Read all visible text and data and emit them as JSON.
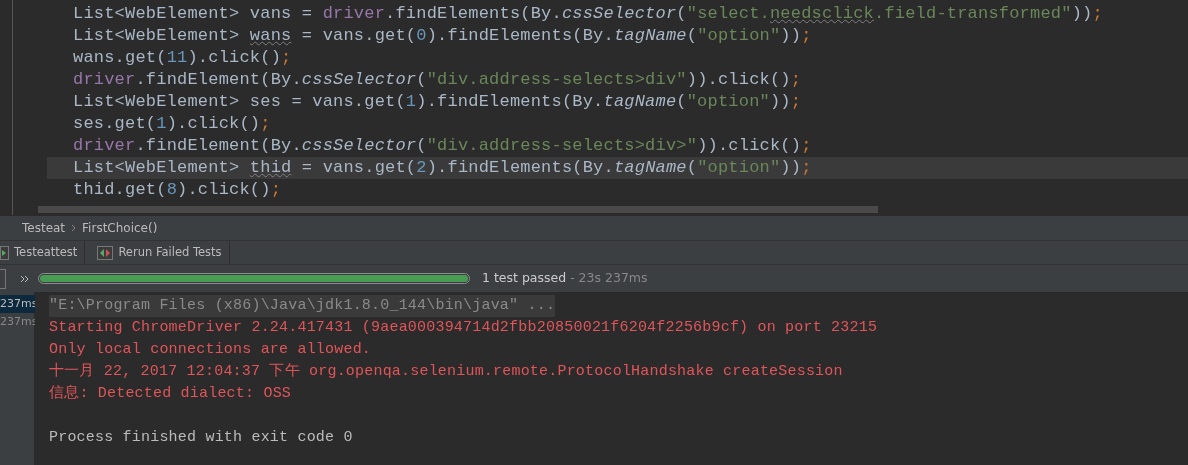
{
  "editor": {
    "lines": [
      {
        "current": false,
        "tokens": [
          {
            "kind": "plain",
            "text": "List<WebElement> vans = "
          },
          {
            "kind": "field",
            "text": "driver"
          },
          {
            "kind": "plain",
            "text": ".findElements(By."
          },
          {
            "kind": "static",
            "text": "cssSelector"
          },
          {
            "kind": "plain",
            "text": "("
          },
          {
            "kind": "string",
            "text": "\"select."
          },
          {
            "kind": "typo-string",
            "text": "needsclick"
          },
          {
            "kind": "string",
            "text": ".field-transformed\""
          },
          {
            "kind": "plain",
            "text": "))"
          },
          {
            "kind": "punct",
            "text": ";"
          }
        ]
      },
      {
        "current": false,
        "tokens": [
          {
            "kind": "plain",
            "text": "List<WebElement> "
          },
          {
            "kind": "typo",
            "text": "wans"
          },
          {
            "kind": "plain",
            "text": " = vans.get("
          },
          {
            "kind": "number",
            "text": "0"
          },
          {
            "kind": "plain",
            "text": ").findElements(By."
          },
          {
            "kind": "static",
            "text": "tagName"
          },
          {
            "kind": "plain",
            "text": "("
          },
          {
            "kind": "string",
            "text": "\"option\""
          },
          {
            "kind": "plain",
            "text": "))"
          },
          {
            "kind": "punct",
            "text": ";"
          }
        ]
      },
      {
        "current": false,
        "tokens": [
          {
            "kind": "plain",
            "text": "wans.get("
          },
          {
            "kind": "number",
            "text": "11"
          },
          {
            "kind": "plain",
            "text": ").click()"
          },
          {
            "kind": "punct",
            "text": ";"
          }
        ]
      },
      {
        "current": false,
        "tokens": [
          {
            "kind": "field",
            "text": "driver"
          },
          {
            "kind": "plain",
            "text": ".findElement(By."
          },
          {
            "kind": "static",
            "text": "cssSelector"
          },
          {
            "kind": "plain",
            "text": "("
          },
          {
            "kind": "string",
            "text": "\"div.address-selects>div\""
          },
          {
            "kind": "plain",
            "text": ")).click()"
          },
          {
            "kind": "punct",
            "text": ";"
          }
        ]
      },
      {
        "current": false,
        "tokens": [
          {
            "kind": "plain",
            "text": "List<WebElement> ses = vans.get("
          },
          {
            "kind": "number",
            "text": "1"
          },
          {
            "kind": "plain",
            "text": ").findElements(By."
          },
          {
            "kind": "static",
            "text": "tagName"
          },
          {
            "kind": "plain",
            "text": "("
          },
          {
            "kind": "string",
            "text": "\"option\""
          },
          {
            "kind": "plain",
            "text": "))"
          },
          {
            "kind": "punct",
            "text": ";"
          }
        ]
      },
      {
        "current": false,
        "tokens": [
          {
            "kind": "plain",
            "text": "ses.get("
          },
          {
            "kind": "number",
            "text": "1"
          },
          {
            "kind": "plain",
            "text": ").click()"
          },
          {
            "kind": "punct",
            "text": ";"
          }
        ]
      },
      {
        "current": false,
        "tokens": [
          {
            "kind": "field",
            "text": "driver"
          },
          {
            "kind": "plain",
            "text": ".findElement(By."
          },
          {
            "kind": "static",
            "text": "cssSelector"
          },
          {
            "kind": "plain",
            "text": "("
          },
          {
            "kind": "string",
            "text": "\"div.address-selects>div>\""
          },
          {
            "kind": "plain",
            "text": ")).click()"
          },
          {
            "kind": "punct",
            "text": ";"
          }
        ]
      },
      {
        "current": true,
        "tokens": [
          {
            "kind": "plain",
            "text": "List<WebElement> "
          },
          {
            "kind": "typo",
            "text": "thid"
          },
          {
            "kind": "plain",
            "text": " = vans.get("
          },
          {
            "kind": "number",
            "text": "2"
          },
          {
            "kind": "plain",
            "text": ").findElements(By."
          },
          {
            "kind": "static",
            "text": "tagName"
          },
          {
            "kind": "plain",
            "text": "("
          },
          {
            "kind": "string",
            "text": "\"option\""
          },
          {
            "kind": "plain",
            "text": "))"
          },
          {
            "kind": "punct",
            "text": ";"
          }
        ]
      },
      {
        "current": false,
        "tokens": [
          {
            "kind": "plain",
            "text": "thid.get("
          },
          {
            "kind": "number",
            "text": "8"
          },
          {
            "kind": "plain",
            "text": ").click()"
          },
          {
            "kind": "punct",
            "text": ";"
          }
        ]
      }
    ]
  },
  "breadcrumb": [
    "Testeat",
    "FirstChoice()"
  ],
  "tabs": [
    {
      "label": "Testeattest",
      "selected": false
    },
    {
      "label": "Rerun Failed Tests",
      "selected": false
    }
  ],
  "progress": {
    "level": 1.0,
    "status": "1 test passed",
    "time": " - 23s 237ms"
  },
  "tree": [
    {
      "time": "237ms",
      "selected": true
    },
    {
      "time": "237ms",
      "selected": false
    }
  ],
  "console": [
    {
      "kind": "command",
      "text": "\"E:\\Program Files (x86)\\Java\\jdk1.8.0_144\\bin\\java\" ..."
    },
    {
      "kind": "error",
      "text": "Starting ChromeDriver 2.24.417431 (9aea000394714d2fbb20850021f6204f2256b9cf) on port 23215"
    },
    {
      "kind": "error",
      "text": "Only local connections are allowed."
    },
    {
      "kind": "error",
      "text": "十一月 22, 2017 12:04:37 下午 org.openqa.selenium.remote.ProtocolHandshake createSession"
    },
    {
      "kind": "error",
      "text": "信息: Detected dialect: OSS"
    },
    {
      "kind": "blank"
    },
    {
      "kind": "normal",
      "text": "Process finished with exit code 0"
    }
  ]
}
